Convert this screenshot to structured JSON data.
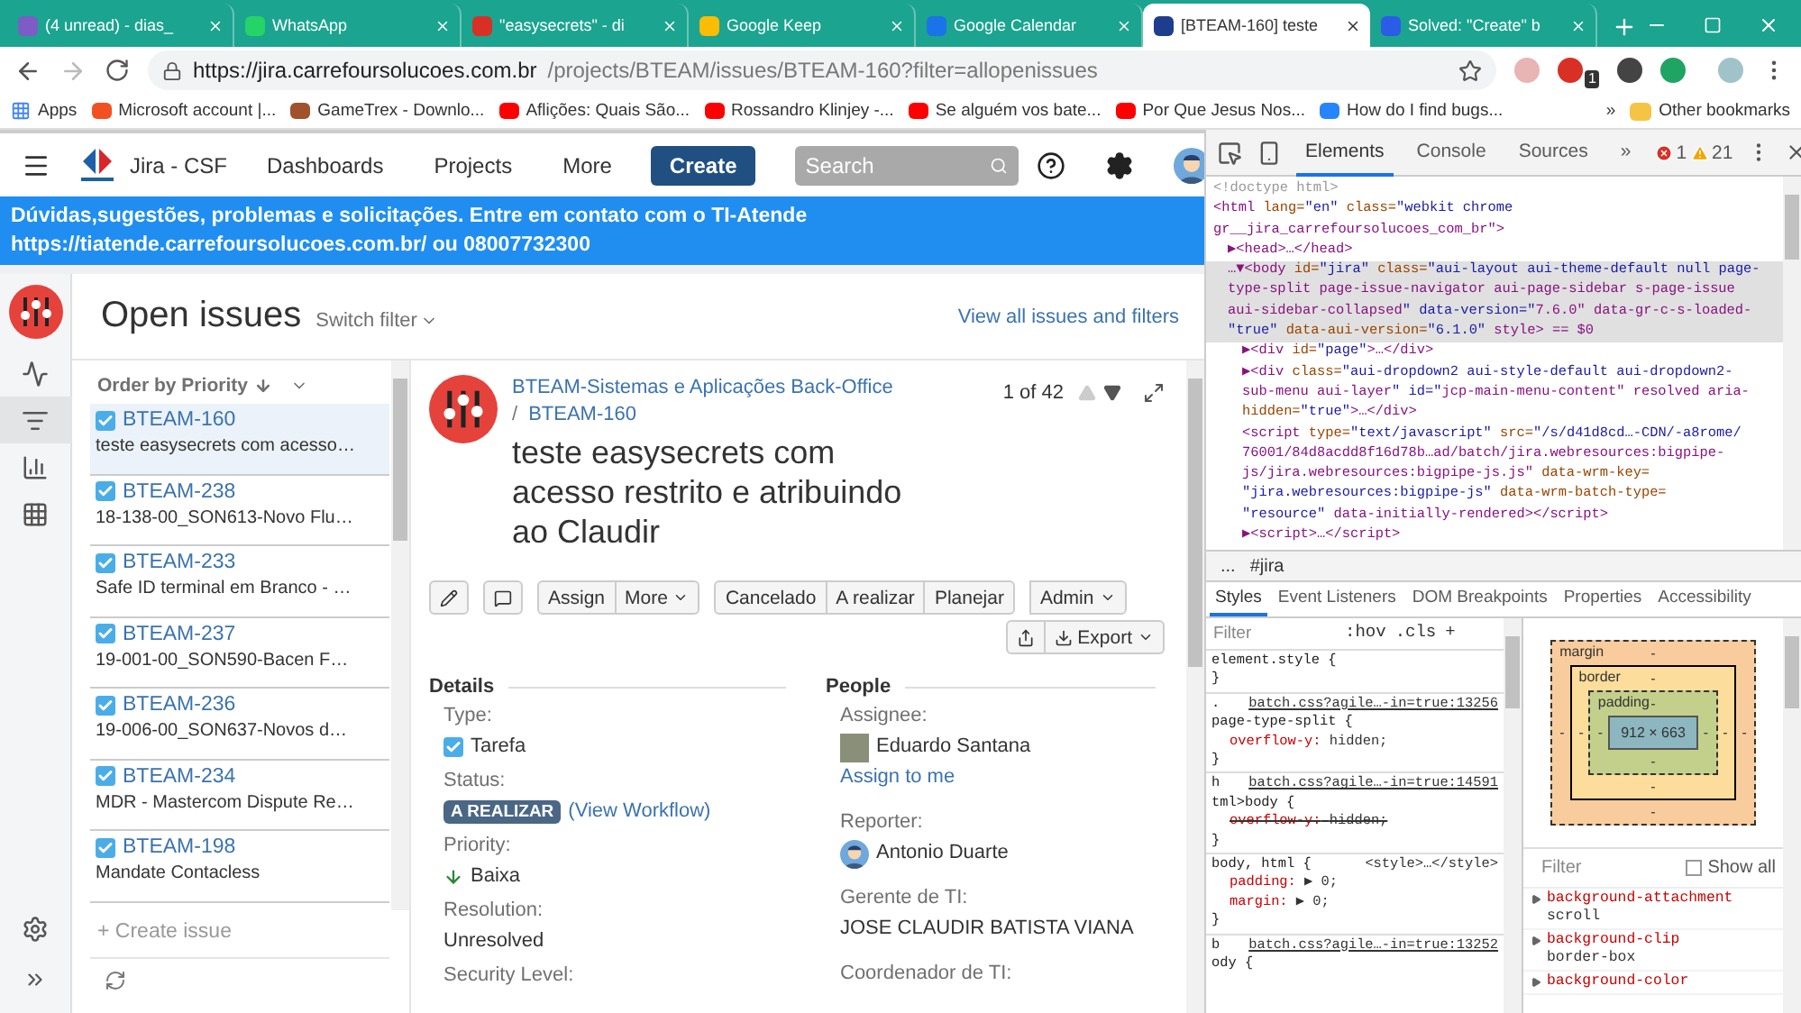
{
  "browser": {
    "tabs": [
      {
        "title": "(4 unread) - dias_",
        "selected": false
      },
      {
        "title": "WhatsApp",
        "selected": false
      },
      {
        "title": "\"easysecrets\" - di",
        "selected": false
      },
      {
        "title": "Google Keep",
        "selected": false
      },
      {
        "title": "Google Calendar",
        "selected": false
      },
      {
        "title": "[BTEAM-160] teste",
        "selected": true
      },
      {
        "title": "Solved: \"Create\" b",
        "selected": false
      }
    ],
    "url_host": "https://jira.carrefoursolucoes.com.br",
    "url_path": "/projects/BTEAM/issues/BTEAM-160?filter=allopenissues",
    "extension_badge": "1",
    "bookmarks": [
      "Apps",
      "Microsoft account |...",
      "GameTrex - Downlo...",
      "Aflições: Quais São...",
      "Rossandro Klinjey -...",
      "Se alguém vos bate...",
      "Por Que Jesus Nos...",
      "How do I find bugs..."
    ],
    "bookmarks_overflow": "»",
    "other_bookmarks": "Other bookmarks"
  },
  "jira": {
    "header": {
      "app_name": "Jira - CSF",
      "nav": [
        "Dashboards",
        "Projects",
        "More"
      ],
      "create": "Create",
      "search_placeholder": "Search"
    },
    "banner": "Dúvidas,sugestões, problemas e solicitações. Entre em contato com o TI-Atende https://tiatende.carrefoursolucoes.com.br/ ou 08007732300",
    "sidebar": {
      "items": [
        {
          "selected": false
        },
        {
          "selected": true
        },
        {
          "selected": false
        },
        {
          "selected": false
        }
      ]
    },
    "filter": {
      "title": "Open issues",
      "switch": "Switch filter",
      "view_all": "View all issues and filters",
      "order": "Order by Priority"
    },
    "issues": [
      {
        "key": "BTEAM-160",
        "summary": "teste easysecrets com acesso…",
        "selected": true
      },
      {
        "key": "BTEAM-238",
        "summary": "18-138-00_SON613-Novo Flu…",
        "selected": false
      },
      {
        "key": "BTEAM-233",
        "summary": "Safe ID terminal em Branco - …",
        "selected": false
      },
      {
        "key": "BTEAM-237",
        "summary": "19-001-00_SON590-Bacen F…",
        "selected": false
      },
      {
        "key": "BTEAM-236",
        "summary": "19-006-00_SON637-Novos d…",
        "selected": false
      },
      {
        "key": "BTEAM-234",
        "summary": "MDR - Mastercom Dispute Re…",
        "selected": false
      },
      {
        "key": "BTEAM-198",
        "summary": "Mandate Contacless",
        "selected": false
      }
    ],
    "create_issue": "+ Create issue",
    "issue": {
      "project": "BTEAM-Sistemas e Aplicações Back-Office",
      "separator": "/",
      "key": "BTEAM-160",
      "summary": "teste easysecrets com acesso restrito e atribuindo ao Claudir",
      "pager": "1 of 42",
      "action_groups": [
        [
          {
            "label": "Assign",
            "dropdown": false
          },
          {
            "label": "More",
            "dropdown": true
          }
        ],
        [
          {
            "label": "Cancelado",
            "dropdown": false
          },
          {
            "label": "A realizar",
            "dropdown": false
          },
          {
            "label": "Planejar",
            "dropdown": false
          }
        ],
        [
          {
            "label": "Admin",
            "dropdown": true
          }
        ]
      ],
      "export": "Export",
      "details_title": "Details",
      "details": [
        {
          "label": "Type:",
          "kind": "type",
          "value": "Tarefa"
        },
        {
          "label": "Status:",
          "kind": "status",
          "value": "A REALIZAR",
          "link": "(View Workflow)"
        },
        {
          "label": "Priority:",
          "kind": "priority",
          "value": "Baixa"
        },
        {
          "label": "Resolution:",
          "kind": "text",
          "value": "Unresolved"
        },
        {
          "label": "Security Level:",
          "kind": "text"
        }
      ],
      "people_title": "People",
      "people": [
        {
          "label": "Assignee:",
          "kind": "photo",
          "value": "Eduardo Santana",
          "link": "Assign to me"
        },
        {
          "label": "Reporter:",
          "kind": "avatar",
          "value": "Antonio Duarte"
        },
        {
          "label": "Gerente de TI:",
          "kind": "text",
          "value": "JOSE CLAUDIR BATISTA VIANA"
        },
        {
          "label": "Coordenador de TI:",
          "kind": "text"
        }
      ]
    }
  },
  "devtools": {
    "tabs": [
      {
        "label": "Elements",
        "selected": true
      },
      {
        "label": "Console",
        "selected": false
      },
      {
        "label": "Sources",
        "selected": false
      }
    ],
    "more_tabs": "»",
    "errors": "1",
    "warnings": "21",
    "dom": [
      {
        "kind": "doctype",
        "selected": false,
        "lines": [
          "<!doctype html>"
        ]
      },
      {
        "kind": "element",
        "selected": false,
        "lines": [
          "<html lang=\"en\" class=\"webkit chrome",
          "gr__jira_carrefoursolucoes_com_br\">"
        ],
        "children": [
          {
            "kind": "element",
            "selected": false,
            "lines": [
              "▶<head>…</head>"
            ]
          },
          {
            "kind": "element",
            "selected": true,
            "lines": [
              "…▼<body id=\"jira\" class=\"aui-layout aui-theme-default null page-",
              "type-split page-issue-navigator aui-page-sidebar s-page-issue",
              "aui-sidebar-collapsed\" data-version=\"7.6.0\" data-gr-c-s-loaded-",
              "\"true\" data-aui-version=\"6.1.0\" style> == $0"
            ],
            "children": [
              {
                "kind": "element",
                "selected": false,
                "lines": [
                  "▶<div id=\"page\">…</div>"
                ]
              },
              {
                "kind": "element",
                "selected": false,
                "lines": [
                  "▶<div class=\"aui-dropdown2 aui-style-default aui-dropdown2-",
                  "sub-menu aui-layer\" id=\"jcp-main-menu-content\" resolved aria-",
                  "hidden=\"true\">…</div>"
                ]
              },
              {
                "kind": "element",
                "selected": false,
                "lines": [
                  "<script type=\"text/javascript\" src=\"/s/d41d8cd…-CDN/-a8rome/",
                  "76001/84d8acdd8f16d78b…ad/batch/jira.webresources:bigpipe-",
                  "js/jira.webresources:bigpipe-js.js\" data-wrm-key=",
                  "\"jira.webresources:bigpipe-js\" data-wrm-batch-type=",
                  "\"resource\" data-initially-rendered></script>"
                ]
              },
              {
                "kind": "element",
                "selected": false,
                "lines": [
                  "▶<script>…</script>"
                ]
              }
            ]
          }
        ]
      }
    ],
    "breadcrumb": [
      "...",
      "#jira"
    ],
    "pane_tabs": [
      {
        "label": "Styles",
        "selected": true
      },
      {
        "label": "Event Listeners",
        "selected": false
      },
      {
        "label": "DOM Breakpoints",
        "selected": false
      },
      {
        "label": "Properties",
        "selected": false
      },
      {
        "label": "Accessibility",
        "selected": false
      }
    ],
    "styles": {
      "filter_placeholder": "Filter",
      "hov": ":hov",
      "cls": ".cls",
      "add": "+",
      "rules": [
        {
          "head": "element.style {",
          "close": "}"
        },
        {
          "head": ".",
          "source": "batch.css?agile…-in=true:13256",
          "source_link": true,
          "selector": "page-type-split {",
          "declarations": [
            {
              "prop": "overflow-y:",
              "value": "hidden;",
              "struck": false
            }
          ],
          "close": "}"
        },
        {
          "head": "h",
          "source": "batch.css?agile…-in=true:14591",
          "source_link": true,
          "selector": "tml>body {",
          "declarations": [
            {
              "prop": "overflow-y:",
              "value": "hidden;",
              "struck": true
            }
          ],
          "close": "}"
        },
        {
          "head": "body, html {",
          "source": "<style>…</style>",
          "source_link": false,
          "declarations": [
            {
              "prop": "padding:",
              "value": "▶ 0;",
              "struck": false
            },
            {
              "prop": "margin:",
              "value": "▶ 0;",
              "struck": false
            }
          ],
          "close": "}"
        },
        {
          "head": "b",
          "source": "batch.css?agile…-in=true:13252",
          "source_link": true,
          "selector": "ody {"
        }
      ]
    },
    "box_model": {
      "margin": {
        "label": "margin",
        "top": "-",
        "right": "-",
        "bottom": "-",
        "left": "-"
      },
      "border": {
        "label": "border",
        "top": "-",
        "right": "-",
        "bottom": "-",
        "left": "-"
      },
      "padding": {
        "label": "padding",
        "top": "-",
        "right": "-",
        "bottom": "-",
        "left": "-"
      },
      "content": "912 × 663"
    },
    "computed": {
      "filter_placeholder": "Filter",
      "show_all": "Show all",
      "show_all_checked": false,
      "properties": [
        {
          "name": "background-attachment",
          "value": "scroll"
        },
        {
          "name": "background-clip",
          "value": "border-box"
        },
        {
          "name": "background-color"
        }
      ]
    }
  }
}
